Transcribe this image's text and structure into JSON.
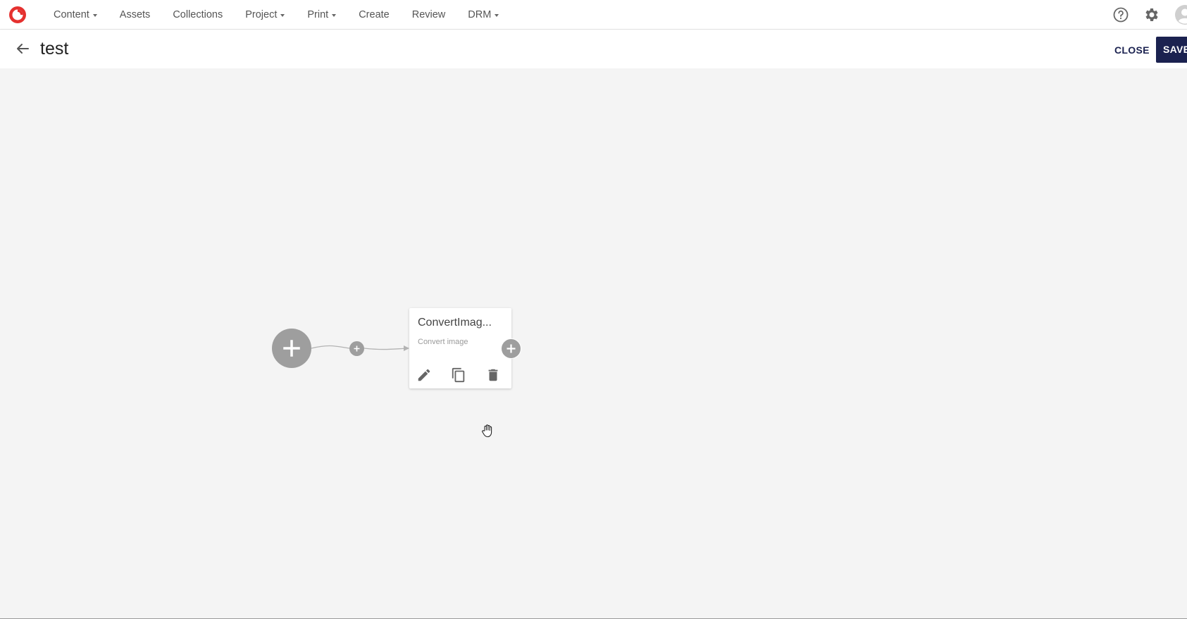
{
  "nav": {
    "items": [
      {
        "label": "Content",
        "dropdown": true
      },
      {
        "label": "Assets",
        "dropdown": false
      },
      {
        "label": "Collections",
        "dropdown": false
      },
      {
        "label": "Project",
        "dropdown": true
      },
      {
        "label": "Print",
        "dropdown": true
      },
      {
        "label": "Create",
        "dropdown": false
      },
      {
        "label": "Review",
        "dropdown": false
      },
      {
        "label": "DRM",
        "dropdown": true
      }
    ],
    "logo_icon": "brand-logo-icon",
    "help_icon": "help-circle-icon",
    "settings_icon": "gear-icon",
    "avatar_icon": "user-avatar-icon"
  },
  "header": {
    "title": "test",
    "close_label": "CLOSE",
    "save_label": "SAVE"
  },
  "workflow": {
    "step": {
      "title": "ConvertImag...",
      "subtitle": "Convert image"
    }
  },
  "colors": {
    "brand_red": "#e5312f",
    "primary_navy": "#1b2250",
    "node_gray": "#9e9e9e",
    "canvas_bg": "#f4f4f4"
  }
}
